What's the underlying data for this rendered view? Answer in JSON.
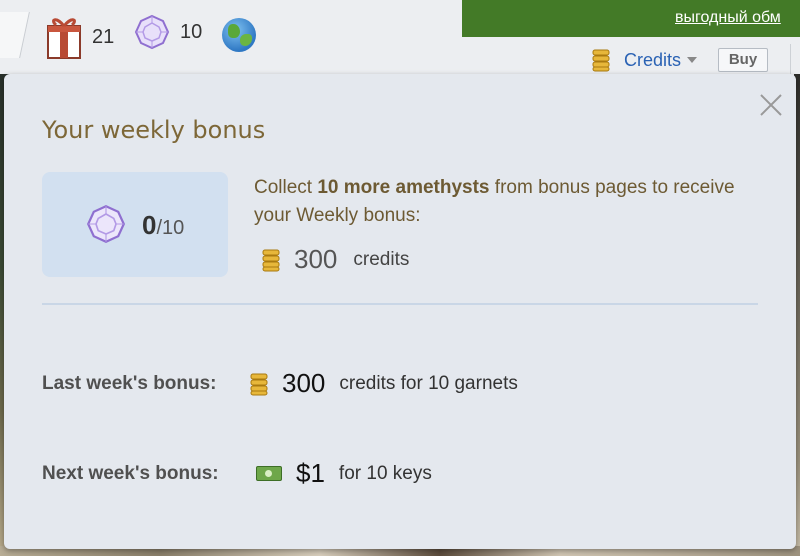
{
  "topbar": {
    "gifts_count": "21",
    "amethysts_count": "10",
    "promo_link": "выгодный обм",
    "credits_label": "Credits",
    "buy_label": "Buy"
  },
  "weekly_bonus": {
    "title": "Your weekly bonus",
    "progress_count": "0",
    "progress_total": "/10",
    "desc_prefix": "Collect ",
    "desc_bold": "10 more amethysts",
    "desc_suffix": " from bonus pages to receive your Weekly bonus:",
    "reward_amount": "300",
    "reward_unit": "credits",
    "last_week_label": "Last week's bonus:",
    "last_week_amount": "300",
    "last_week_desc": "credits for 10 garnets",
    "next_week_label": "Next week's bonus:",
    "next_week_amount": "$1",
    "next_week_desc": "for 10 keys"
  },
  "icons": [
    "gift-icon",
    "amethyst-icon",
    "globe-icon",
    "coin-stack-icon",
    "caret-down-icon",
    "close-icon",
    "dollar-bill-icon"
  ],
  "colors": {
    "title": "#7d6737",
    "credits_link": "#2a62b4",
    "promo_bar": "#437a27",
    "progress_box": "#d2e0f0",
    "amethyst": "#8f6fd0"
  }
}
